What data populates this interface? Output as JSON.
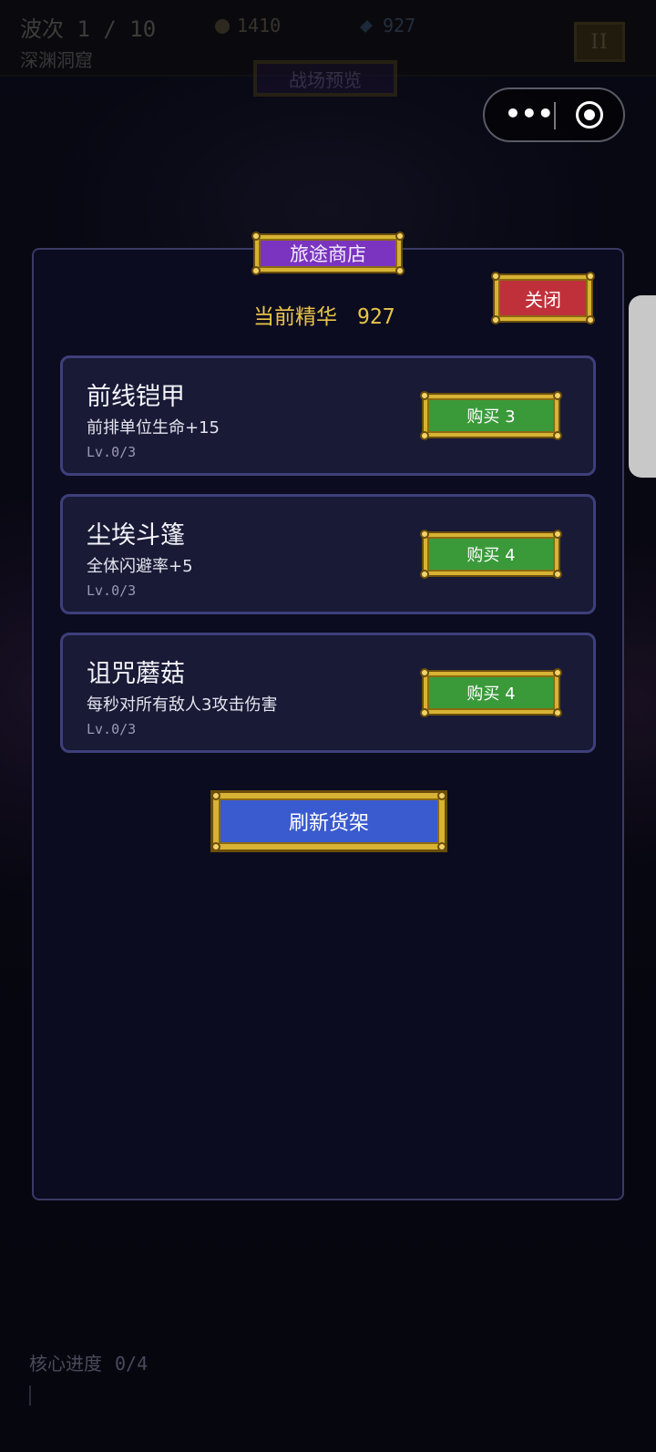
{
  "hud": {
    "wave": "波次 1 / 10",
    "level_name": "深渊洞窟",
    "gold": "1410",
    "gems": "927",
    "pause_label": "II",
    "preview_label": "战场预览"
  },
  "shop": {
    "title": "旅途商店",
    "close_label": "关闭",
    "essence_label": "当前精华",
    "essence_value": "927",
    "items": [
      {
        "name": "前线铠甲",
        "desc": "前排单位生命+15",
        "level": "Lv.0/3",
        "buy_label": "购买 3"
      },
      {
        "name": "尘埃斗篷",
        "desc": "全体闪避率+5",
        "level": "Lv.0/3",
        "buy_label": "购买 4"
      },
      {
        "name": "诅咒蘑菇",
        "desc": "每秒对所有敌人3攻击伤害",
        "level": "Lv.0/3",
        "buy_label": "购买 4"
      }
    ],
    "refresh_label": "刷新货架"
  },
  "core": {
    "label": "核心进度",
    "value": "0/4"
  },
  "colors": {
    "gold_frame": "#d8b234",
    "title_purple": "#7a34c0",
    "close_red": "#c0303a",
    "buy_green": "#3a9a3a",
    "refresh_blue": "#3a5ad0",
    "essence_yellow": "#e8c44a"
  },
  "icons": [
    "coin-icon",
    "gem-icon",
    "more-dots-icon",
    "target-icon"
  ]
}
